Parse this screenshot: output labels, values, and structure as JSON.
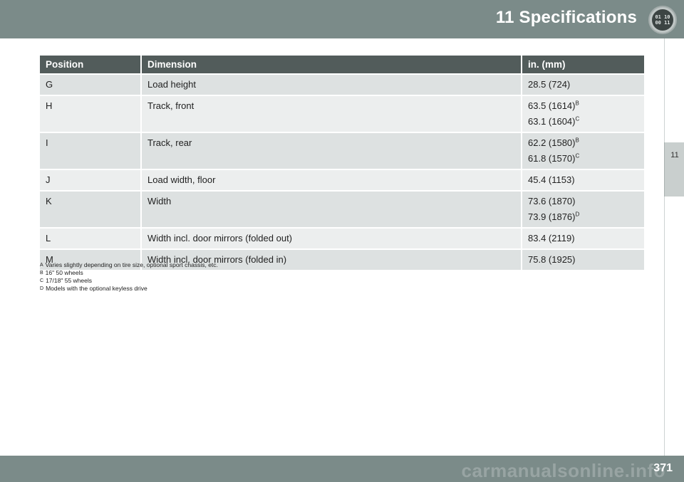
{
  "header": {
    "title": "11 Specifications",
    "badge_lines": [
      "01 10",
      "00 11"
    ]
  },
  "side_tab": {
    "chapter": "11"
  },
  "table": {
    "columns": [
      "Position",
      "Dimension",
      "in. (mm)"
    ],
    "rows": [
      {
        "position": "G",
        "dimension": "Load height",
        "values": [
          {
            "text": "28.5 (724)",
            "note": ""
          }
        ]
      },
      {
        "position": "H",
        "dimension": "Track, front",
        "values": [
          {
            "text": "63.5 (1614)",
            "note": "B"
          },
          {
            "text": "63.1 (1604)",
            "note": "C"
          }
        ]
      },
      {
        "position": "I",
        "dimension": "Track, rear",
        "values": [
          {
            "text": "62.2 (1580)",
            "note": "B"
          },
          {
            "text": "61.8 (1570)",
            "note": "C"
          }
        ]
      },
      {
        "position": "J",
        "dimension": "Load width, floor",
        "values": [
          {
            "text": "45.4 (1153)",
            "note": ""
          }
        ]
      },
      {
        "position": "K",
        "dimension": "Width",
        "values": [
          {
            "text": "73.6 (1870)",
            "note": ""
          },
          {
            "text": "73.9 (1876)",
            "note": "D"
          }
        ]
      },
      {
        "position": "L",
        "dimension": "Width incl. door mirrors (folded out)",
        "values": [
          {
            "text": "83.4 (2119)",
            "note": ""
          }
        ]
      },
      {
        "position": "M",
        "dimension": "Width incl. door mirrors (folded in)",
        "values": [
          {
            "text": "75.8 (1925)",
            "note": ""
          }
        ]
      }
    ]
  },
  "footnotes": [
    {
      "marker": "A",
      "text": "Varies slightly depending on tire size, optional sport chassis, etc."
    },
    {
      "marker": "B",
      "text": "16\" 50 wheels"
    },
    {
      "marker": "C",
      "text": "17/18\" 55 wheels"
    },
    {
      "marker": "D",
      "text": "Models with the optional keyless drive"
    }
  ],
  "footer": {
    "page_number": "371",
    "watermark": "carmanualsonline.info"
  },
  "colors": {
    "header_bar": "#7b8b89",
    "table_header": "#525c5b",
    "row_odd": "#dde1e1",
    "row_even": "#eceeee"
  }
}
